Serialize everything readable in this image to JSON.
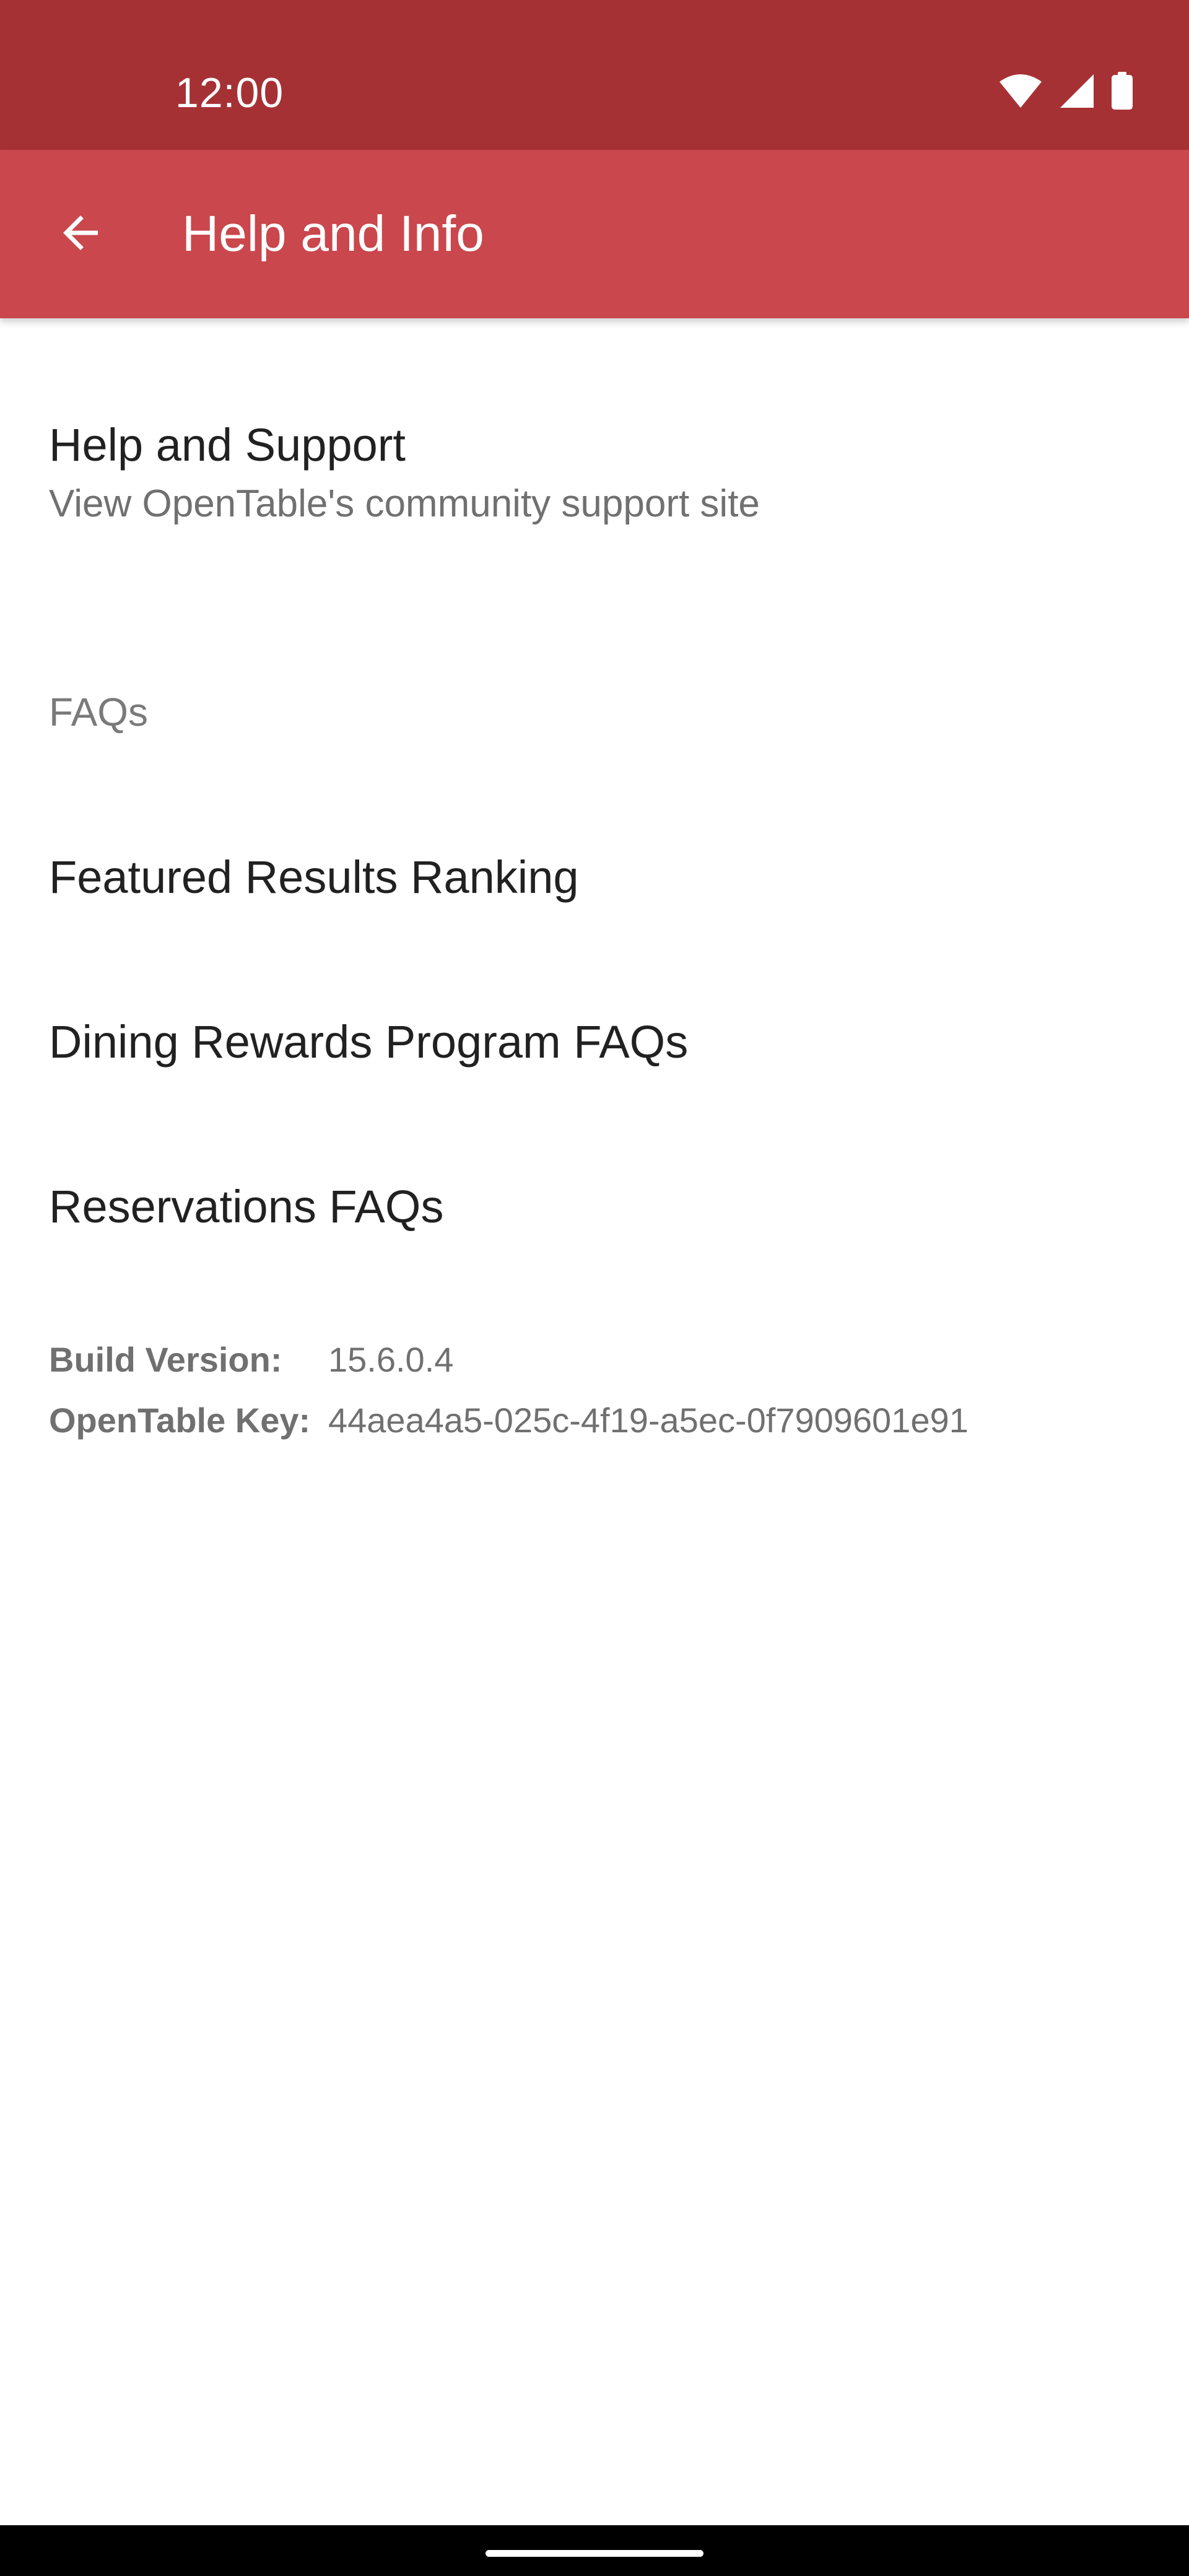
{
  "status_bar": {
    "time": "12:00",
    "background": "#A63135",
    "icons": [
      "wifi-icon",
      "signal-icon",
      "battery-icon"
    ]
  },
  "app_bar": {
    "title": "Help and Info",
    "background": "#C9474D",
    "back_icon": "arrow-back-icon"
  },
  "support": {
    "title": "Help and Support",
    "subtitle": "View OpenTable's community support site"
  },
  "faqs": {
    "header": "FAQs",
    "items": [
      {
        "label": "Featured Results Ranking"
      },
      {
        "label": "Dining Rewards Program FAQs"
      },
      {
        "label": "Reservations FAQs"
      }
    ]
  },
  "info": {
    "build_label": "Build Version:",
    "build_value": "15.6.0.4",
    "key_label": "OpenTable Key:",
    "key_value": "44aea4a5-025c-4f19-a5ec-0f7909601e91"
  },
  "nav_bar": {
    "background": "#000000"
  }
}
